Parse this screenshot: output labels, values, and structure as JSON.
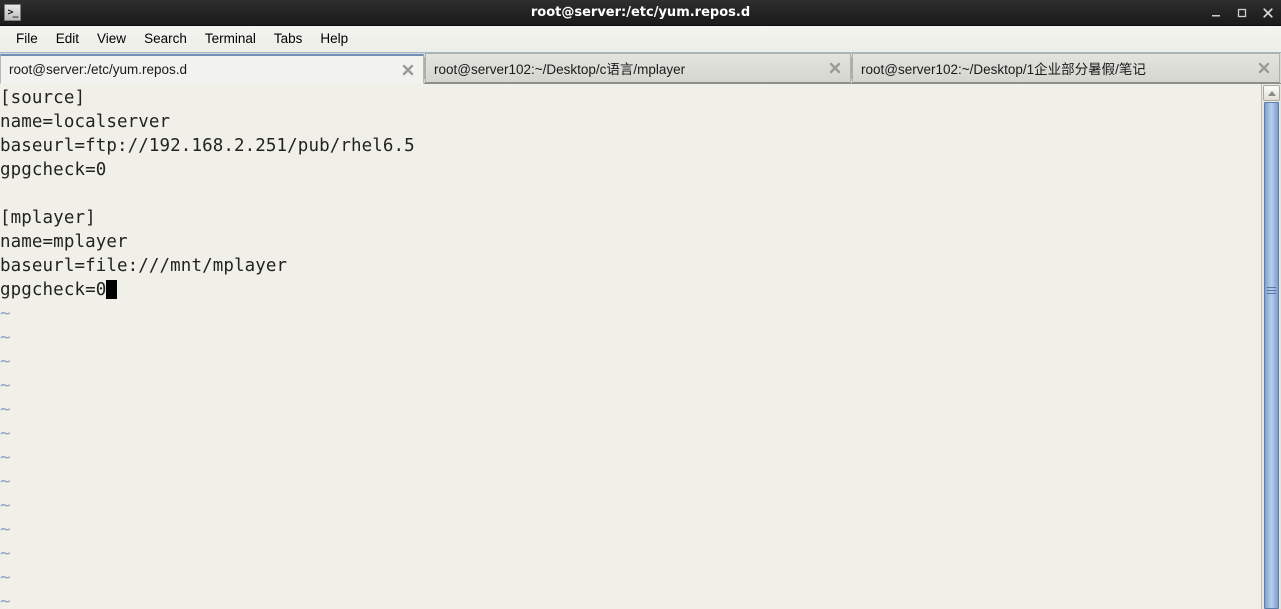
{
  "window": {
    "title": "root@server:/etc/yum.repos.d",
    "icon": "terminal-icon",
    "icon_glyph": ">_",
    "controls": {
      "minimize_label": "–",
      "maximize_label": "□",
      "close_label": "×"
    },
    "colors": {
      "titlebar_bg": "#242424",
      "titlebar_text": "#ffffff",
      "menubar_bg": "#f1f1ec",
      "terminal_bg": "#f0f0e8",
      "terminal_text": "#222222",
      "tilde_color": "#8fa2bf",
      "scrollbar_thumb": "#a7c0e4",
      "active_tab_bg": "#f2f2ee",
      "inactive_tab_bg": "#dcdcd6"
    }
  },
  "menubar": {
    "items": [
      {
        "label": "File"
      },
      {
        "label": "Edit"
      },
      {
        "label": "View"
      },
      {
        "label": "Search"
      },
      {
        "label": "Terminal"
      },
      {
        "label": "Tabs"
      },
      {
        "label": "Help"
      }
    ]
  },
  "tabs": [
    {
      "label": "root@server:/etc/yum.repos.d",
      "active": true,
      "close_icon": "close-icon"
    },
    {
      "label": "root@server102:~/Desktop/c语言/mplayer",
      "active": false,
      "close_icon": "close-icon"
    },
    {
      "label": "root@server102:~/Desktop/1企业部分暑假/笔记",
      "active": false,
      "close_icon": "close-icon"
    }
  ],
  "terminal": {
    "lines": [
      {
        "text": "[source]",
        "type": "text"
      },
      {
        "text": "name=localserver",
        "type": "text"
      },
      {
        "text": "baseurl=ftp://192.168.2.251/pub/rhel6.5",
        "type": "text"
      },
      {
        "text": "gpgcheck=0",
        "type": "text"
      },
      {
        "text": "",
        "type": "text"
      },
      {
        "text": "[mplayer]",
        "type": "text"
      },
      {
        "text": "name=mplayer",
        "type": "text"
      },
      {
        "text": "baseurl=file:///mnt/mplayer",
        "type": "text"
      },
      {
        "text": "gpgcheck=0",
        "type": "cursor"
      },
      {
        "text": "~",
        "type": "tilde"
      },
      {
        "text": "~",
        "type": "tilde"
      },
      {
        "text": "~",
        "type": "tilde"
      },
      {
        "text": "~",
        "type": "tilde"
      },
      {
        "text": "~",
        "type": "tilde"
      },
      {
        "text": "~",
        "type": "tilde"
      },
      {
        "text": "~",
        "type": "tilde"
      },
      {
        "text": "~",
        "type": "tilde"
      },
      {
        "text": "~",
        "type": "tilde"
      },
      {
        "text": "~",
        "type": "tilde"
      },
      {
        "text": "~",
        "type": "tilde"
      },
      {
        "text": "~",
        "type": "tilde"
      },
      {
        "text": "~",
        "type": "tilde"
      }
    ]
  },
  "scrollbar": {
    "up_arrow_icon": "chevron-up-icon",
    "grip_icon": "grip-lines-icon"
  }
}
